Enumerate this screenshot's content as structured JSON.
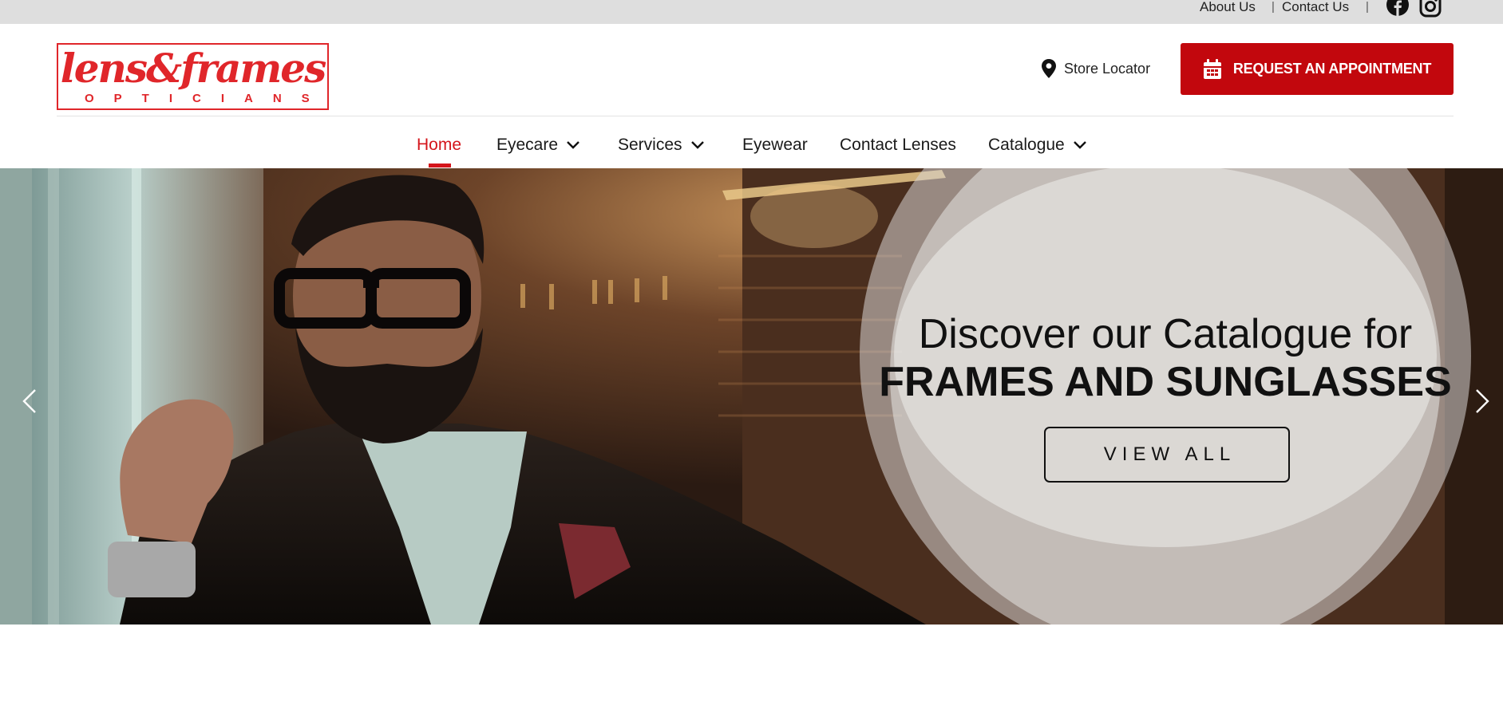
{
  "topbar": {
    "about": "About Us",
    "contact": "Contact Us",
    "separator": "|",
    "social": [
      "facebook-icon",
      "instagram-icon"
    ]
  },
  "brand": {
    "wordmark": "lens&frames",
    "tagline": "OPTICIANS",
    "color": "#e0262a"
  },
  "header": {
    "store_locator": "Store Locator",
    "appointment_button": "REQUEST AN APPOINTMENT",
    "appointment_color": "#c2070d"
  },
  "nav": {
    "items": [
      {
        "label": "Home",
        "active": true
      },
      {
        "label": "Eyecare",
        "dropdown": true
      },
      {
        "label": "Services",
        "dropdown": true
      },
      {
        "label": "Eyewear"
      },
      {
        "label": "Contact Lenses"
      },
      {
        "label": "Catalogue",
        "dropdown": true
      }
    ],
    "active_color": "#d4151b"
  },
  "hero": {
    "heading_line1": "Discover our Catalogue for",
    "heading_line2": "FRAMES AND SUNGLASSES",
    "cta": "VIEW ALL"
  }
}
